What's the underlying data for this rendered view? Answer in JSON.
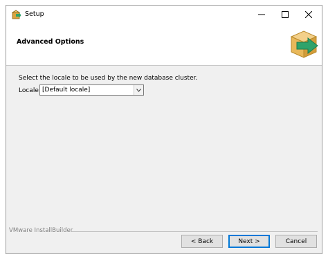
{
  "window": {
    "title": "Setup"
  },
  "titlebar": {
    "minimize": "—",
    "maximize": "☐",
    "close": "✕"
  },
  "header": {
    "title": "Advanced Options"
  },
  "main": {
    "prompt": "Select the locale to be used by the new database cluster.",
    "locale": {
      "label": "Locale",
      "selected": "[Default locale]"
    }
  },
  "footer": {
    "branding": "VMware InstallBuilder",
    "back_label": "< Back",
    "next_label": "Next >",
    "cancel_label": "Cancel"
  },
  "colors": {
    "accent": "#0078d7",
    "box": "#e8b85a",
    "arrow": "#2fa36b"
  }
}
